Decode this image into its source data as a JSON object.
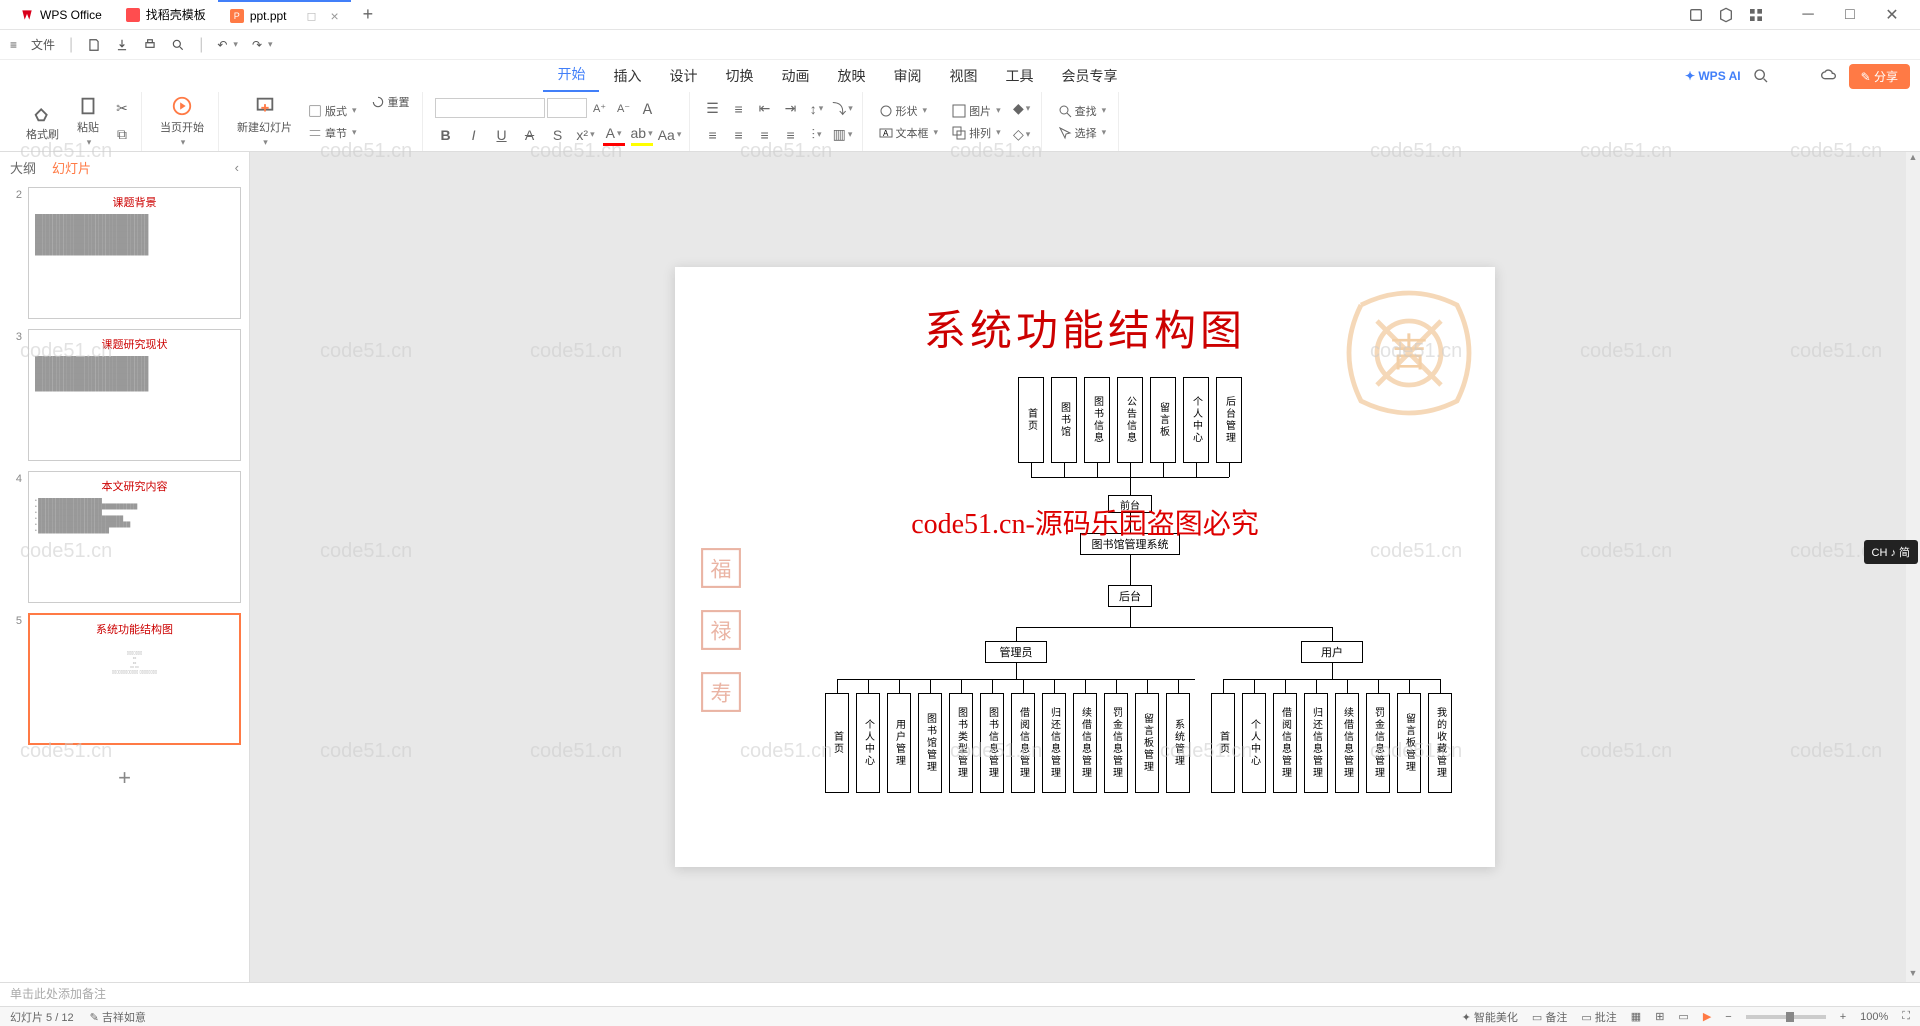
{
  "titlebar": {
    "tabs": [
      {
        "label": "WPS Office"
      },
      {
        "label": "找稻壳模板"
      },
      {
        "label": "ppt.ppt",
        "active": true,
        "type": "P"
      }
    ]
  },
  "quickbar": {
    "file": "文件"
  },
  "ribbonTabs": [
    "开始",
    "插入",
    "设计",
    "切换",
    "动画",
    "放映",
    "审阅",
    "视图",
    "工具",
    "会员专享"
  ],
  "ribbonActive": "开始",
  "ribbonRight": {
    "ai": "WPS AI",
    "share": "分享"
  },
  "ribbonGroups": {
    "formatPainter": "格式刷",
    "paste": "粘贴",
    "currentPageStart": "当页开始",
    "newSlide": "新建幻灯片",
    "layout": "版式",
    "section": "章节",
    "reset": "重置",
    "shape": "形状",
    "picture": "图片",
    "textbox": "文本框",
    "arrange": "排列",
    "find": "查找",
    "select": "选择"
  },
  "panel": {
    "tabs": [
      "大纲",
      "幻灯片"
    ],
    "active": "幻灯片"
  },
  "thumbnails": [
    {
      "num": 2,
      "title": "课题背景"
    },
    {
      "num": 3,
      "title": "课题研究现状"
    },
    {
      "num": 4,
      "title": "本文研究内容"
    },
    {
      "num": 5,
      "title": "系统功能结构图",
      "active": true
    }
  ],
  "slide": {
    "title": "系统功能结构图",
    "watermark_red": "code51.cn-源码乐园盗图必究",
    "row1": [
      "首页",
      "图书馆",
      "图书信息",
      "公告信息",
      "留言板",
      "个人中心",
      "后台管理"
    ],
    "mid1": "前台",
    "center": "图书馆管理系统",
    "mid2": "后台",
    "branch_left": "管理员",
    "branch_right": "用户",
    "row_admin": [
      "首页",
      "个人中心",
      "用户管理",
      "图书馆管理",
      "图书类型管理",
      "图书信息管理",
      "借阅信息管理",
      "归还信息管理",
      "续借信息管理",
      "罚金信息管理",
      "留言板管理",
      "系统管理"
    ],
    "row_user": [
      "首页",
      "个人中心",
      "借阅信息管理",
      "归还信息管理",
      "续借信息管理",
      "罚金信息管理",
      "留言板管理",
      "我的收藏管理"
    ]
  },
  "watermark": "code51.cn",
  "notes_placeholder": "单击此处添加备注",
  "status": {
    "left": "幻灯片 5 / 12",
    "design": "吉祥如意",
    "spellcheck": "智能美化",
    "notes": "备注",
    "comments": "批注",
    "zoom": "100%"
  },
  "lang": "CH ♪ 简"
}
